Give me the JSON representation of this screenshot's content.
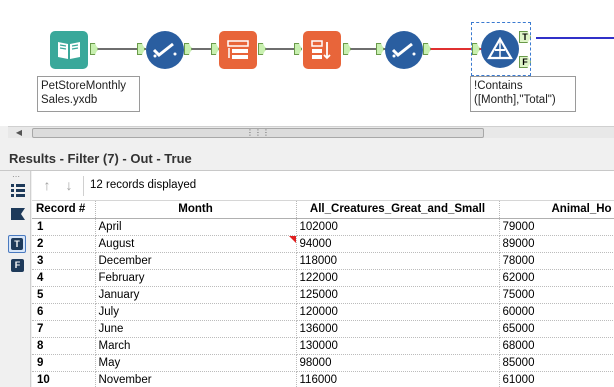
{
  "workflow": {
    "input_caption": "PetStoreMonthly\nSales.yxdb",
    "filter_caption": "!Contains\n([Month],\"Total\")",
    "true_anchor": "T",
    "false_anchor": "F",
    "colors": {
      "connector": "#6e6e6e",
      "true_output_connector": "#3030c8",
      "filter_input_connector": "#e03030",
      "tool_blue": "#2a5ea0",
      "tool_orange": "#e8653a",
      "tool_teal": "#3aa89a"
    }
  },
  "results": {
    "title": "Results - Filter (7) - Out - True",
    "record_count_text": "12 records displayed",
    "columns": [
      "Record #",
      "Month",
      "All_Creatures_Great_and_Small",
      "Animal_Ho"
    ],
    "rows": [
      [
        "1",
        "April",
        "102000",
        "79000"
      ],
      [
        "2",
        "August",
        "94000",
        "89000"
      ],
      [
        "3",
        "December",
        "118000",
        "78000"
      ],
      [
        "4",
        "February",
        "122000",
        "62000"
      ],
      [
        "5",
        "January",
        "125000",
        "75000"
      ],
      [
        "6",
        "July",
        "120000",
        "60000"
      ],
      [
        "7",
        "June",
        "136000",
        "65000"
      ],
      [
        "8",
        "March",
        "130000",
        "68000"
      ],
      [
        "9",
        "May",
        "98000",
        "85000"
      ],
      [
        "10",
        "November",
        "116000",
        "61000"
      ]
    ]
  },
  "sidebar": {
    "icons": [
      "list-view-icon",
      "metadata-icon",
      "true-output-icon",
      "false-output-icon"
    ],
    "true_label": "T",
    "false_label": "F"
  }
}
